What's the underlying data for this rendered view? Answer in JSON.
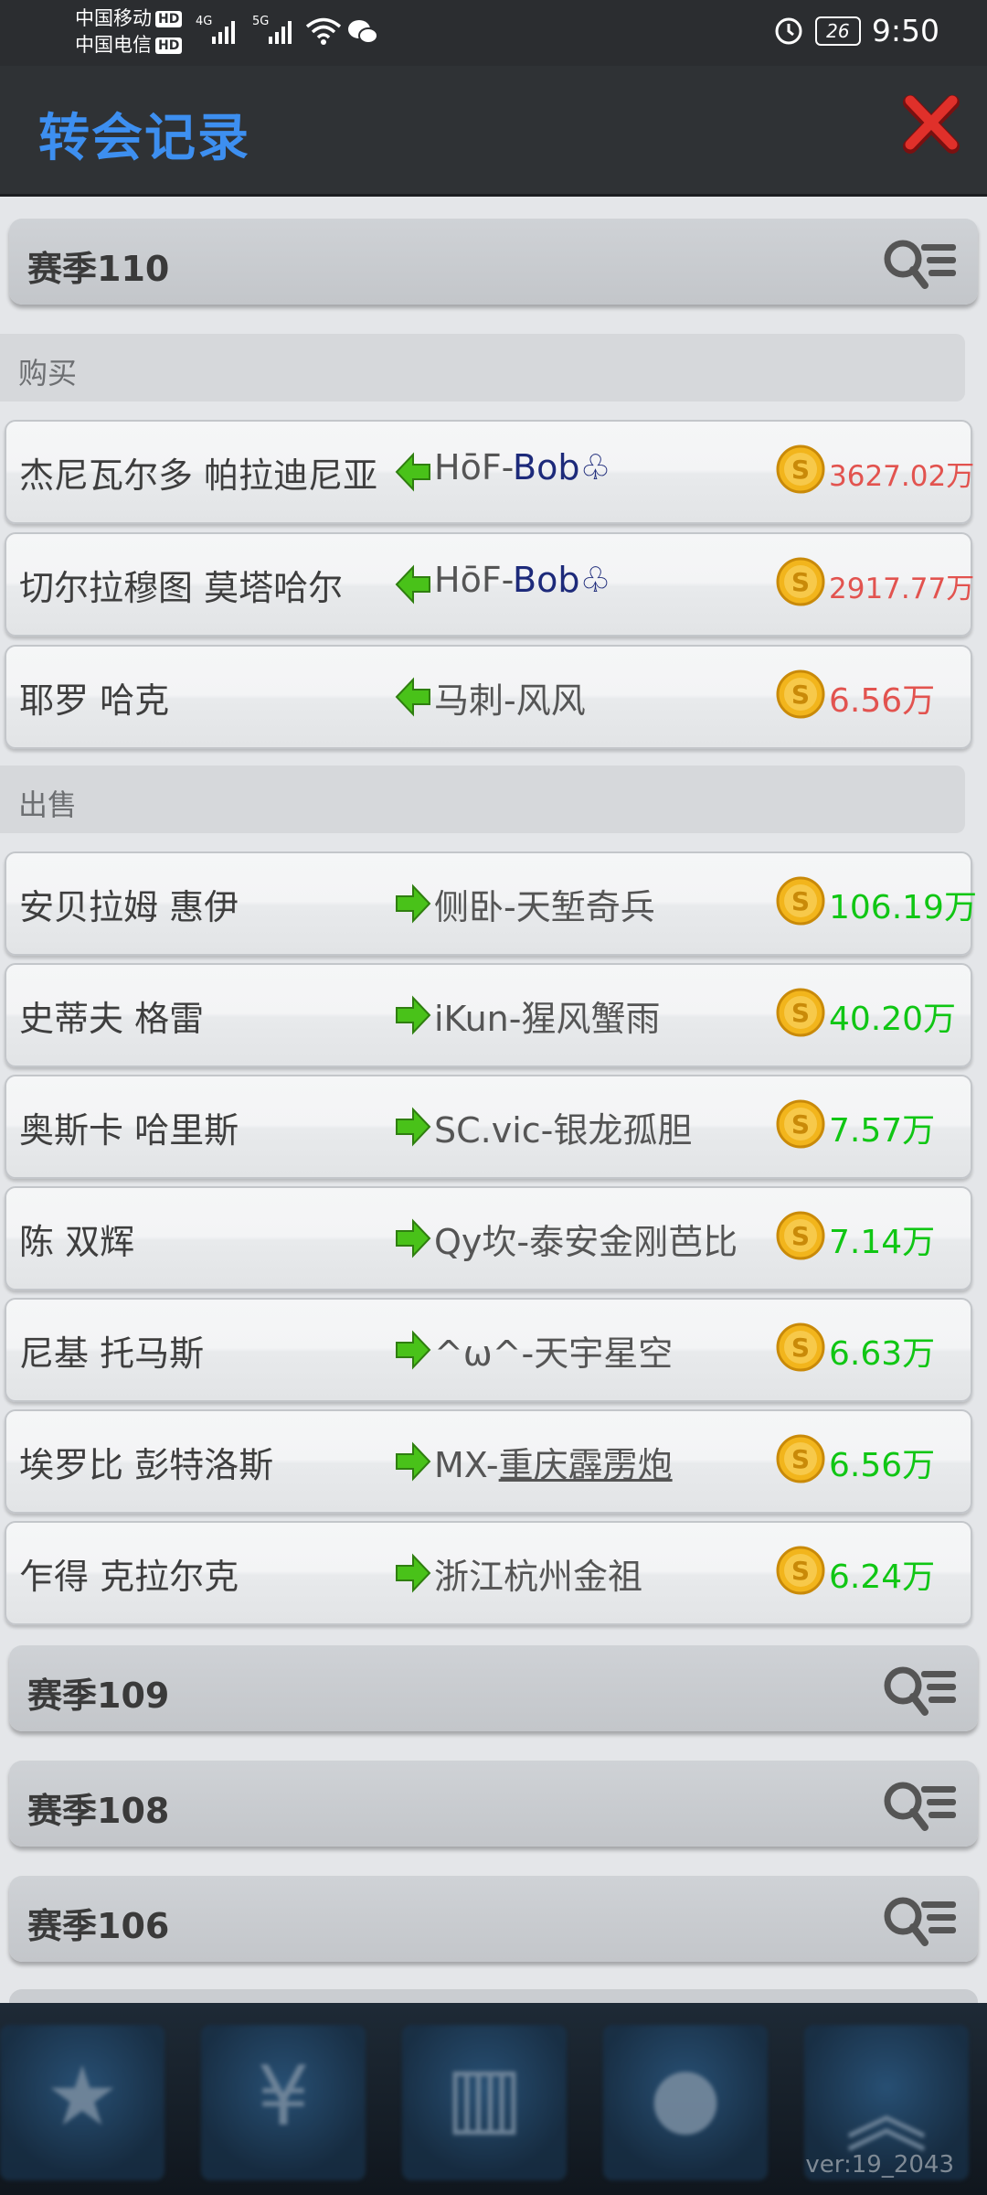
{
  "status_bar": {
    "carrier1": "中国移动",
    "carrier2": "中国电信",
    "hd": "HD",
    "net1": "4G",
    "net2": "5G",
    "battery": "26",
    "time": "9:50"
  },
  "header": {
    "title": "转会记录"
  },
  "seasons": [
    {
      "label": "赛季110",
      "sections": [
        {
          "label": "购买",
          "type": "buy",
          "rows": [
            {
              "player": "杰尼瓦尔多 帕拉迪尼亚",
              "club_prefix": "HōF-",
              "club_name": "Bob",
              "club_suffix": "♧",
              "amount": "3627.02万"
            },
            {
              "player": "切尔拉穆图 莫塔哈尔",
              "club_prefix": "HōF-",
              "club_name": "Bob",
              "club_suffix": "♧",
              "amount": "2917.77万"
            },
            {
              "player": "耶罗 哈克",
              "club_prefix": "",
              "club_name": "马刺-风风",
              "club_suffix": "",
              "amount": "6.56万"
            }
          ]
        },
        {
          "label": "出售",
          "type": "sell",
          "rows": [
            {
              "player": "安贝拉姆 惠伊",
              "club_prefix": "",
              "club_name": "侧卧-天堑奇兵",
              "club_suffix": "",
              "amount": "106.19万"
            },
            {
              "player": "史蒂夫 格雷",
              "club_prefix": "",
              "club_name": "iKun-猩风蟹雨",
              "club_suffix": "",
              "amount": "40.20万"
            },
            {
              "player": "奥斯卡 哈里斯",
              "club_prefix": "",
              "club_name": "SC.vic-银龙孤胆",
              "club_suffix": "",
              "amount": "7.57万"
            },
            {
              "player": "陈 双辉",
              "club_prefix": "",
              "club_name": "Qy坎-泰安金刚芭比",
              "club_suffix": "",
              "amount": "7.14万"
            },
            {
              "player": "尼基 托马斯",
              "club_prefix": "",
              "club_name": "^ω^-天宇星空",
              "club_suffix": "",
              "amount": "6.63万"
            },
            {
              "player": "埃罗比 彭特洛斯",
              "club_prefix": "MX-",
              "club_name": "重庆霹雳炮",
              "club_suffix": "",
              "amount": "6.56万",
              "underline": true
            },
            {
              "player": "乍得 克拉尔克",
              "club_prefix": "",
              "club_name": "浙江杭州金祖",
              "club_suffix": "",
              "amount": "6.24万"
            }
          ]
        }
      ]
    },
    {
      "label": "赛季109"
    },
    {
      "label": "赛季108"
    },
    {
      "label": "赛季106"
    }
  ],
  "bottom_nav": {
    "icons": [
      "star-icon",
      "yen-icon",
      "building-icon",
      "chat-icon",
      "chevron-up-icon"
    ],
    "version": "ver:19_2043"
  },
  "colors": {
    "title": "#3d8ff0",
    "buy_amount": "#e2534f",
    "sell_amount": "#10c614"
  }
}
